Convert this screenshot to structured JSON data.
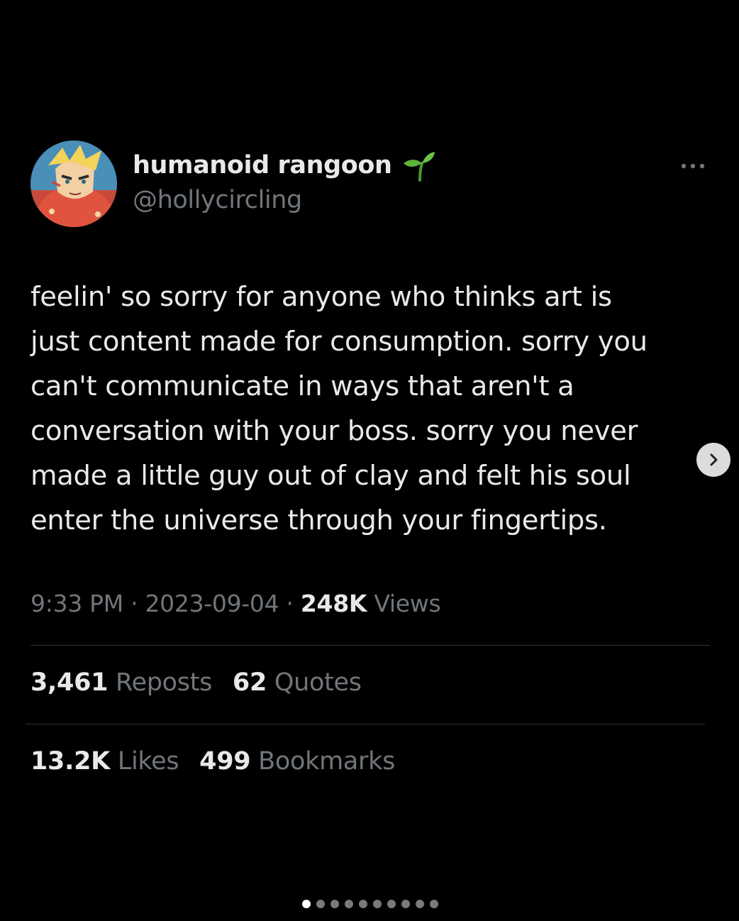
{
  "user": {
    "display_name": "humanoid rangoon",
    "handle": "@hollycircling",
    "name_emoji_icon": "sprout-icon",
    "avatar_icon": "cartoon-avatar"
  },
  "tweet": {
    "lines": [
      "feelin' so sorry for anyone who thinks art is",
      "just content made for consumption. sorry you",
      "can't communicate in ways that aren't a",
      "conversation with your boss. sorry you never",
      "made a little guy out of clay and felt his soul",
      "enter the universe through your fingertips."
    ],
    "time": "9:33 PM",
    "separator": "·",
    "date": "2023-09-04",
    "views_count": "248K",
    "views_label": "Views"
  },
  "stats": {
    "reposts_count": "3,461",
    "reposts_label": "Reposts",
    "quotes_count": "62",
    "quotes_label": "Quotes",
    "likes_count": "13.2K",
    "likes_label": "Likes",
    "bookmarks_count": "499",
    "bookmarks_label": "Bookmarks"
  },
  "carousel": {
    "total_slides": 10,
    "active_index": 0,
    "next_icon": "chevron-right-icon"
  },
  "colors": {
    "background": "#000000",
    "primary_text": "#e7e9ea",
    "secondary_text": "#71767b",
    "divider": "#2f3336",
    "sprout_green": "#5fb23a"
  }
}
